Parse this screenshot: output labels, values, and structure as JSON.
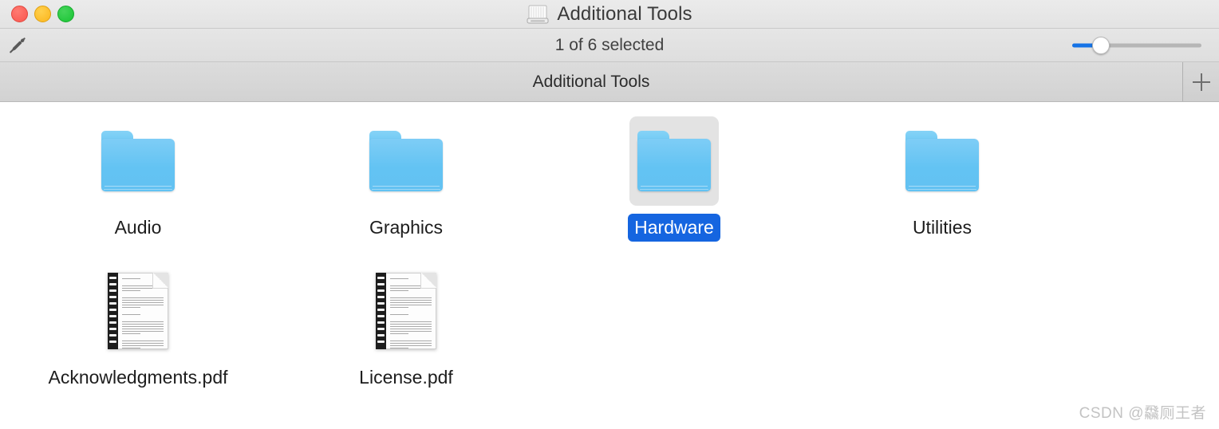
{
  "window": {
    "title": "Additional Tools",
    "title_icon": "disk-drive-icon",
    "traffic_lights": {
      "close": "close-button",
      "minimize": "minimize-button",
      "maximize": "maximize-button"
    }
  },
  "statusbar": {
    "markup_icon": "markup-pen-slash-icon",
    "selection_text": "1 of 6 selected",
    "zoom_slider": {
      "name": "icon-size-slider",
      "value_percent": 22,
      "fill_color": "#1573e6"
    }
  },
  "tabbar": {
    "tabs": [
      {
        "label": "Additional Tools",
        "active": true
      }
    ],
    "new_tab_icon": "plus-icon"
  },
  "content": {
    "accent_color": "#1565E0",
    "selected_bg": "#e3e3e3",
    "items": [
      {
        "name": "Audio",
        "kind": "folder",
        "selected": false
      },
      {
        "name": "Graphics",
        "kind": "folder",
        "selected": false
      },
      {
        "name": "Hardware",
        "kind": "folder",
        "selected": true
      },
      {
        "name": "Utilities",
        "kind": "folder",
        "selected": false
      },
      {
        "name": "Acknowledgments.pdf",
        "kind": "pdf",
        "selected": false
      },
      {
        "name": "License.pdf",
        "kind": "pdf",
        "selected": false
      }
    ]
  },
  "watermark": {
    "text": "CSDN @飝厕王者"
  }
}
